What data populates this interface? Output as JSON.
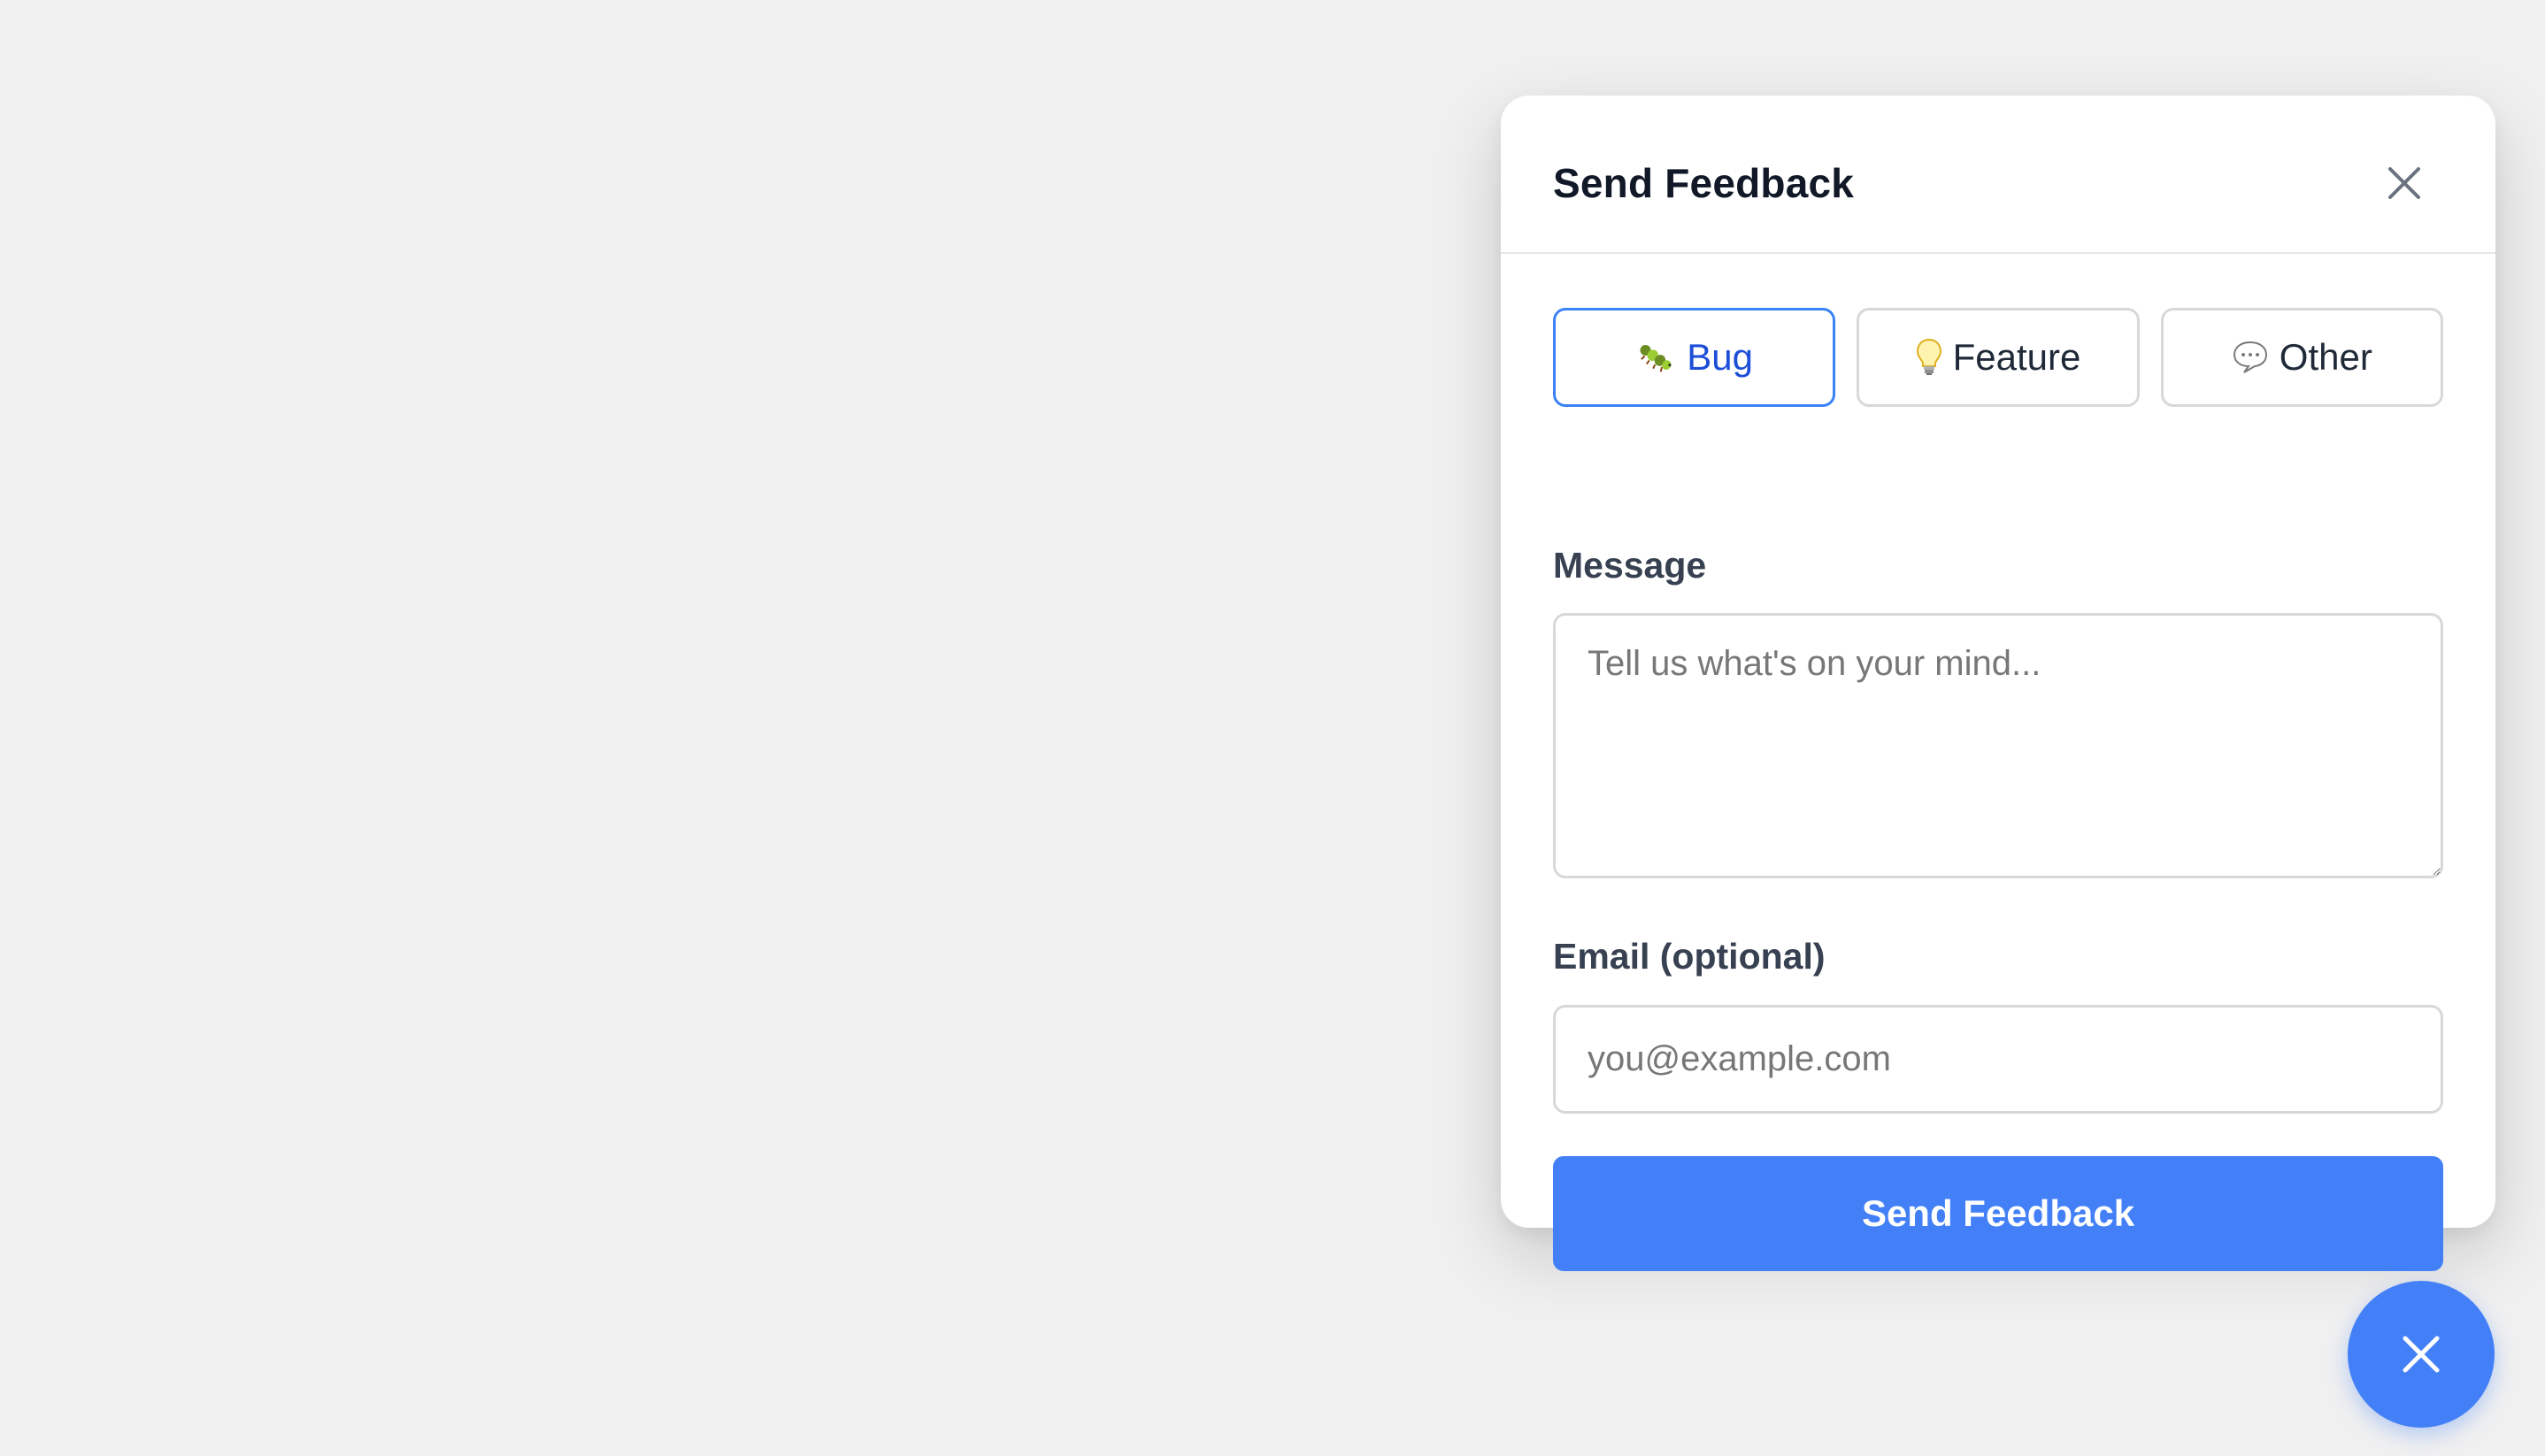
{
  "panel": {
    "title": "Send Feedback",
    "close_icon": "close-icon"
  },
  "feedback_types": [
    {
      "label": "Bug",
      "icon": "bug-icon",
      "selected": true
    },
    {
      "label": "Feature",
      "icon": "lightbulb-icon",
      "selected": false
    },
    {
      "label": "Other",
      "icon": "speech-bubble-icon",
      "selected": false
    }
  ],
  "message": {
    "label": "Message",
    "value": "",
    "placeholder": "Tell us what's on your mind..."
  },
  "email": {
    "label": "Email (optional)",
    "value": "",
    "placeholder": "you@example.com"
  },
  "submit": {
    "label": "Send Feedback"
  },
  "fab": {
    "icon": "close-icon"
  },
  "colors": {
    "accent": "#4380f8",
    "selected_text": "#1d4ed8",
    "selected_border": "#3b82f6",
    "background": "#f0f0f0"
  }
}
